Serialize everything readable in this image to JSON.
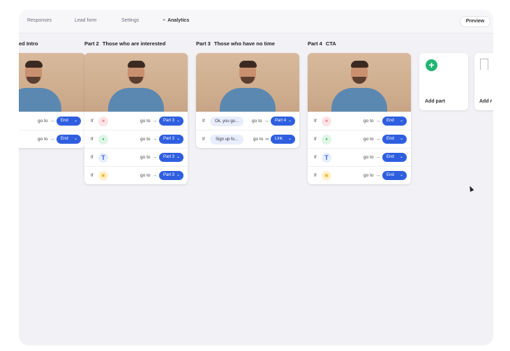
{
  "nav": {
    "items": [
      "Responses",
      "Lead form",
      "Settings",
      "Analytics"
    ],
    "analytics_icon": "chart-icon",
    "preview": "Preview"
  },
  "parts": [
    {
      "title": "ed Intro",
      "rows": [
        {
          "goto": "go to",
          "target": "End"
        },
        {
          "goto": "go to",
          "target": "End"
        }
      ]
    },
    {
      "number": "Part 2",
      "title": "Those who are interested",
      "rows": [
        {
          "if": "If",
          "icon": "video-icon",
          "goto": "go to",
          "target": "Part 3"
        },
        {
          "if": "If",
          "icon": "mic-icon",
          "goto": "go to",
          "target": "Part 3"
        },
        {
          "if": "If",
          "icon": "T",
          "goto": "go to",
          "target": "Part 3"
        },
        {
          "if": "If",
          "icon": "file-icon",
          "goto": "go to",
          "target": "Part 3"
        }
      ]
    },
    {
      "number": "Part 3",
      "title": "Those who have no time",
      "rows": [
        {
          "if": "If",
          "text": "Ok, you go...",
          "goto": "go to",
          "target": "Part 4"
        },
        {
          "if": "If",
          "text": "Sign up fo...",
          "goto": "go to",
          "target": "Link"
        }
      ]
    },
    {
      "number": "Part 4",
      "title": "CTA",
      "rows": [
        {
          "if": "If",
          "icon": "video-icon",
          "goto": "go to",
          "target": "End"
        },
        {
          "if": "If",
          "icon": "mic-icon",
          "goto": "go to",
          "target": "End"
        },
        {
          "if": "If",
          "icon": "T",
          "goto": "go to",
          "target": "End"
        },
        {
          "if": "If",
          "icon": "file-icon",
          "goto": "go to",
          "target": "End"
        }
      ]
    }
  ],
  "add_part": "Add part",
  "add_r": "Add r",
  "colors": {
    "accent": "#2f5fe0",
    "add": "#22b573"
  }
}
